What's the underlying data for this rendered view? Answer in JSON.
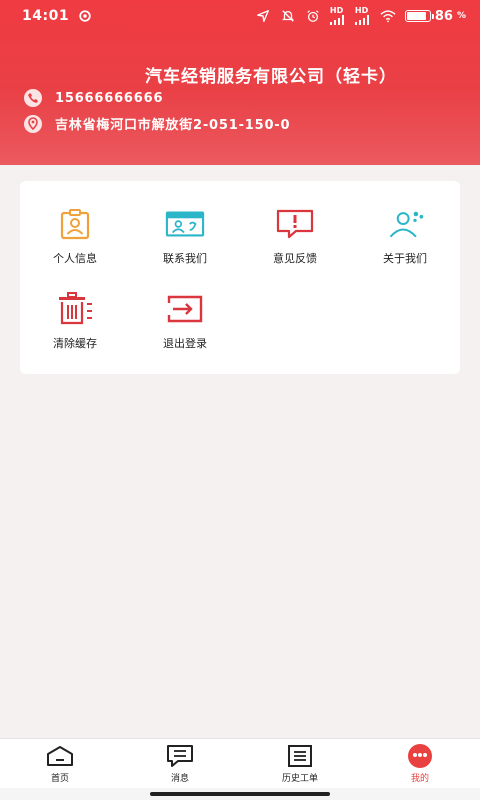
{
  "status_bar": {
    "time": "14:01",
    "battery_text": "86",
    "battery_unit": "%",
    "battery_level": 0.86,
    "signal_label_1": "HD",
    "signal_label_2": "HD",
    "icons": [
      "sync-icon",
      "location-arrow-icon",
      "mute-bell-icon",
      "alarm-icon",
      "signal-icon",
      "signal-icon",
      "wifi-icon",
      "battery-icon"
    ]
  },
  "header": {
    "company_name": "汽车经销服务有限公司（轻卡）",
    "phone": "15666666666",
    "address": "吉林省梅河口市解放街2-051-150-0"
  },
  "menu": {
    "items": [
      {
        "label": "个人信息",
        "icon": "person-badge-icon",
        "color": "#f0a23a"
      },
      {
        "label": "联系我们",
        "icon": "contact-card-icon",
        "color": "#2bb5c9"
      },
      {
        "label": "意见反馈",
        "icon": "feedback-message-icon",
        "color": "#d9363e"
      },
      {
        "label": "关于我们",
        "icon": "group-users-icon",
        "color": "#2bb5c9"
      },
      {
        "label": "清除缓存",
        "icon": "trash-icon",
        "color": "#d9363e"
      },
      {
        "label": "退出登录",
        "icon": "logout-icon",
        "color": "#d9363e"
      }
    ]
  },
  "tabbar": {
    "tabs": [
      {
        "label": "首页",
        "icon": "home-icon",
        "active": false
      },
      {
        "label": "消息",
        "icon": "message-icon",
        "active": false
      },
      {
        "label": "历史工单",
        "icon": "history-order-icon",
        "active": false
      },
      {
        "label": "我的",
        "icon": "profile-icon",
        "active": true
      }
    ]
  },
  "colors": {
    "header_red": "#ec3d43",
    "accent_red": "#e8413f",
    "background": "#f5f1f1"
  }
}
